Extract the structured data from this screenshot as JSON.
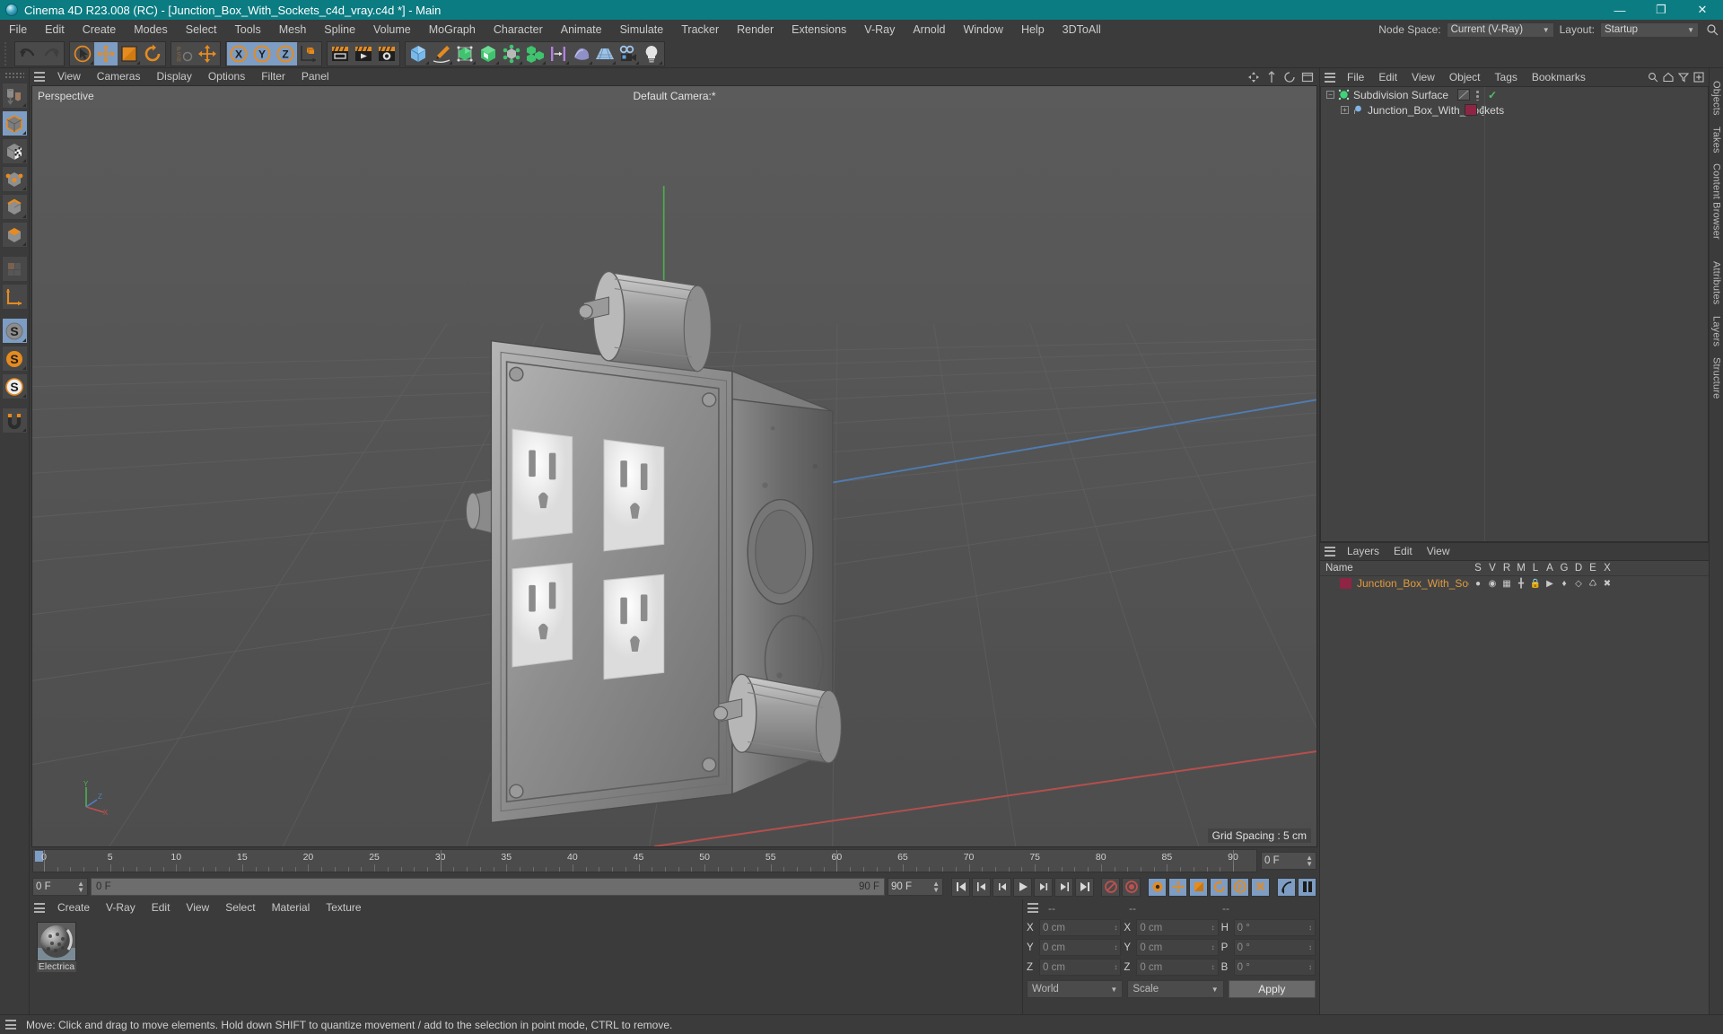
{
  "window": {
    "title": "Cinema 4D R23.008 (RC) - [Junction_Box_With_Sockets_c4d_vray.c4d *] - Main",
    "minimize": "—",
    "maximize": "❐",
    "close": "✕"
  },
  "menubar": {
    "items": [
      "File",
      "Edit",
      "Create",
      "Modes",
      "Select",
      "Tools",
      "Mesh",
      "Spline",
      "Volume",
      "MoGraph",
      "Character",
      "Animate",
      "Simulate",
      "Tracker",
      "Render",
      "Extensions",
      "V-Ray",
      "Arnold",
      "Window",
      "Help",
      "3DToAll"
    ],
    "node_space_label": "Node Space:",
    "node_space_value": "Current (V-Ray)",
    "layout_label": "Layout:",
    "layout_value": "Startup",
    "search_icon": "search-icon"
  },
  "toolbar": {
    "groups": [
      {
        "name": "history",
        "buttons": [
          {
            "name": "undo",
            "icon": "undo-arrow",
            "active": false
          },
          {
            "name": "redo",
            "icon": "redo-arrow",
            "active": false
          }
        ]
      },
      {
        "name": "transform",
        "buttons": [
          {
            "name": "select",
            "icon": "live-selection",
            "active": false
          },
          {
            "name": "move",
            "icon": "move-tool",
            "active": true
          },
          {
            "name": "scale",
            "icon": "scale-tool",
            "active": false
          },
          {
            "name": "rotate",
            "icon": "rotate-tool",
            "active": false
          }
        ]
      },
      {
        "name": "psr",
        "buttons": [
          {
            "name": "psr-lock",
            "icon": "psr-label",
            "active": false
          },
          {
            "name": "world-move",
            "icon": "move-tool",
            "active": false
          }
        ]
      },
      {
        "name": "axis-locks",
        "buttons": [
          {
            "name": "lock-x",
            "icon": "axis-x",
            "active": true
          },
          {
            "name": "lock-y",
            "icon": "axis-y",
            "active": true
          },
          {
            "name": "lock-z",
            "icon": "axis-z",
            "active": true
          },
          {
            "name": "coordinate-system",
            "icon": "world-object-axis",
            "active": false
          }
        ]
      },
      {
        "name": "render",
        "buttons": [
          {
            "name": "render-view",
            "icon": "render-view",
            "active": false
          },
          {
            "name": "render-to-picture-viewer",
            "icon": "render-picture-viewer",
            "active": false
          },
          {
            "name": "render-settings",
            "icon": "render-settings",
            "active": false
          }
        ]
      },
      {
        "name": "create",
        "buttons": [
          {
            "name": "add-cube",
            "icon": "cube-primitive",
            "active": false
          },
          {
            "name": "add-spline",
            "icon": "pen-spline",
            "active": false
          },
          {
            "name": "add-generator",
            "icon": "subdivision-generator",
            "active": false
          },
          {
            "name": "add-spline-generator",
            "icon": "extrude-generator",
            "active": false
          },
          {
            "name": "add-deformer",
            "icon": "bend-deformer",
            "active": false
          },
          {
            "name": "add-mograph",
            "icon": "cloner-mograph",
            "active": false
          },
          {
            "name": "add-field",
            "icon": "field-object",
            "active": false
          },
          {
            "name": "add-landscape",
            "icon": "landscape-object",
            "active": false
          },
          {
            "name": "add-scene",
            "icon": "floor-scene",
            "active": false
          },
          {
            "name": "add-camera",
            "icon": "camera-object",
            "active": false
          },
          {
            "name": "add-light",
            "icon": "light-object",
            "active": false
          }
        ]
      }
    ]
  },
  "leftbar": {
    "buttons": [
      {
        "name": "make-editable",
        "icon": "make-editable",
        "active": false
      },
      {
        "name": "model-mode",
        "icon": "model-mode-cube",
        "active": true
      },
      {
        "name": "texture-mode",
        "icon": "texture-mode-cube",
        "active": false
      },
      {
        "name": "point-mode",
        "icon": "point-mode-cube",
        "active": false
      },
      {
        "name": "edge-mode",
        "icon": "edge-mode-cube",
        "active": false
      },
      {
        "name": "polygon-mode",
        "icon": "polygon-mode-cube",
        "active": false
      },
      {
        "name": "uv-mode",
        "icon": "uv-mode",
        "active": false
      },
      {
        "name": "axis-mode",
        "icon": "axis-mode",
        "active": false
      },
      {
        "name": "enable-snap",
        "icon": "snap-s-grey",
        "active": true
      },
      {
        "name": "quantize-snap",
        "icon": "snap-s-orange",
        "active": false
      },
      {
        "name": "workplane-snap",
        "icon": "snap-s-white",
        "active": false
      },
      {
        "name": "magnet-tool",
        "icon": "magnet-tool",
        "active": false
      }
    ]
  },
  "viewport": {
    "menu": [
      "View",
      "Cameras",
      "Display",
      "Options",
      "Filter",
      "Panel"
    ],
    "label": "Perspective",
    "camera": "Default Camera:*",
    "grid_spacing": "Grid Spacing : 5 cm",
    "axis": {
      "x": "X",
      "y": "Y",
      "z": "Z"
    }
  },
  "timeline": {
    "ticks": [
      0,
      5,
      10,
      15,
      20,
      25,
      30,
      35,
      40,
      45,
      50,
      55,
      60,
      65,
      70,
      75,
      80,
      85,
      90
    ],
    "current_frame": "0 F",
    "start_frame": "0 F",
    "range_start": "0 F",
    "range_end": "90 F",
    "end_frame": "90 F",
    "transport": [
      {
        "name": "go-to-start",
        "icon": "skip-start",
        "active": false
      },
      {
        "name": "previous-key",
        "icon": "prev-key",
        "active": false
      },
      {
        "name": "previous-frame",
        "icon": "step-back",
        "active": false
      },
      {
        "name": "play-forward",
        "icon": "play",
        "active": false
      },
      {
        "name": "next-frame",
        "icon": "step-forward",
        "active": false
      },
      {
        "name": "next-key",
        "icon": "next-key",
        "active": false
      },
      {
        "name": "go-to-end",
        "icon": "skip-end",
        "active": false
      },
      {
        "name": "record-active-objects",
        "icon": "record-forbidden",
        "active": false
      },
      {
        "name": "autokeying",
        "icon": "auto-key",
        "active": false
      },
      {
        "name": "keyframe-selection",
        "icon": "key-selection",
        "active": true
      },
      {
        "name": "position-key",
        "icon": "position-key",
        "active": true
      },
      {
        "name": "scale-key",
        "icon": "scale-key",
        "active": true
      },
      {
        "name": "rotation-key",
        "icon": "rotation-key",
        "active": true
      },
      {
        "name": "parameter-key",
        "icon": "param-key",
        "active": true
      },
      {
        "name": "point-level-animation",
        "icon": "pla-key",
        "active": true
      },
      {
        "name": "dynamics-sim",
        "icon": "dynamics",
        "active": true
      },
      {
        "name": "timeline-toggle",
        "icon": "timeline-toggle",
        "active": true
      }
    ]
  },
  "material_manager": {
    "menu": [
      "Create",
      "V-Ray",
      "Edit",
      "View",
      "Select",
      "Material",
      "Texture"
    ],
    "materials": [
      {
        "name": "Electrica"
      }
    ]
  },
  "coordinates": {
    "header": [
      "--",
      "--",
      "--"
    ],
    "rows": [
      {
        "pos_label": "X",
        "pos_value": "0 cm",
        "size_label": "X",
        "size_value": "0 cm",
        "rot_label": "H",
        "rot_value": "0 °"
      },
      {
        "pos_label": "Y",
        "pos_value": "0 cm",
        "size_label": "Y",
        "size_value": "0 cm",
        "rot_label": "P",
        "rot_value": "0 °"
      },
      {
        "pos_label": "Z",
        "pos_value": "0 cm",
        "size_label": "Z",
        "size_value": "0 cm",
        "rot_label": "B",
        "rot_value": "0 °"
      }
    ],
    "system": "World",
    "mode": "Scale",
    "apply": "Apply"
  },
  "object_manager": {
    "menu": [
      "File",
      "Edit",
      "View",
      "Object",
      "Tags",
      "Bookmarks"
    ],
    "rows": [
      {
        "name": "Subdivision Surface",
        "depth": 0,
        "icon": "subdivision-surface-icon",
        "icon_color": "#3fd47a",
        "tag_color": "#575757",
        "checked": true
      },
      {
        "name": "Junction_Box_With_Sockets",
        "depth": 1,
        "icon": "polygon-object-icon",
        "icon_color": "#7fb4e8",
        "tag_color": "#8e2545",
        "checked": false
      }
    ]
  },
  "layers": {
    "menu": [
      "Layers",
      "Edit",
      "View"
    ],
    "columns": [
      "Name",
      "S",
      "V",
      "R",
      "M",
      "L",
      "A",
      "G",
      "D",
      "E",
      "X"
    ],
    "rows": [
      {
        "name": "Junction_Box_With_Sockets",
        "color": "#8e2545"
      }
    ]
  },
  "vertical_tabs_right": [
    "Objects",
    "Takes",
    "Content Browser"
  ],
  "vertical_tabs_right_lower": [
    "Attributes",
    "Layers",
    "Structure"
  ],
  "statusbar": {
    "message": "Move: Click and drag to move elements. Hold down SHIFT to quantize movement / add to the selection in point mode, CTRL to remove."
  },
  "colors": {
    "title_bg": "#0b7c82",
    "panel_bg": "#3b3b3b",
    "viewport_bg": "#545454",
    "accent_blue": "#7d9dc4",
    "accent_orange": "#e58b20",
    "layer_text": "#e09a3e"
  }
}
